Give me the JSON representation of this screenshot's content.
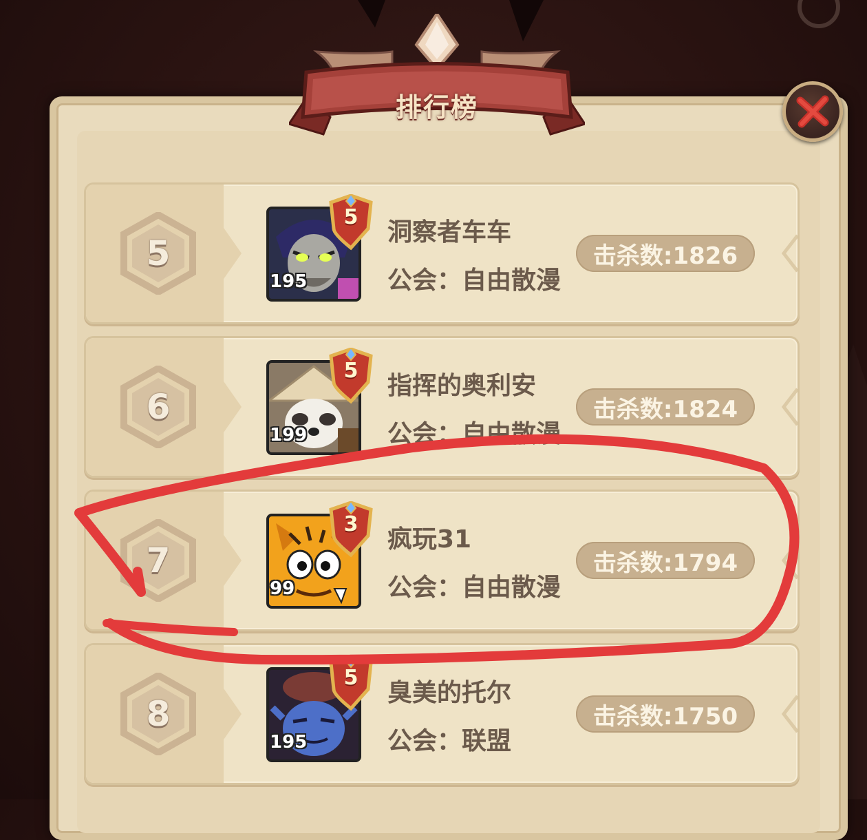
{
  "header": {
    "title": "排行榜"
  },
  "colors": {
    "accent_red": "#e33b3b",
    "panel": "#e9dbbd",
    "badge": "#c7b08f"
  },
  "icons": {
    "close": "close-x-icon",
    "rank": "hexagon-rank-icon",
    "tier": "shield-tier-icon"
  },
  "rows": [
    {
      "rank": "5",
      "name": "洞察者车车",
      "guild": "公会：自由散漫",
      "kills": "击杀数:1826",
      "level": "195",
      "tier": "5",
      "avatar": "vampire-hero"
    },
    {
      "rank": "6",
      "name": "指挥的奥利安",
      "guild": "公会：自由散漫",
      "kills": "击杀数:1824",
      "level": "199",
      "tier": "5",
      "avatar": "panda-monk-hero"
    },
    {
      "rank": "7",
      "name": "疯玩31",
      "guild": "公会：自由散漫",
      "kills": "击杀数:1794",
      "level": "99",
      "tier": "3",
      "avatar": "tiger-hero"
    },
    {
      "rank": "8",
      "name": "臭美的托尔",
      "guild": "公会：联盟",
      "kills": "击杀数:1750",
      "level": "195",
      "tier": "5",
      "avatar": "blue-troll-hero"
    }
  ]
}
